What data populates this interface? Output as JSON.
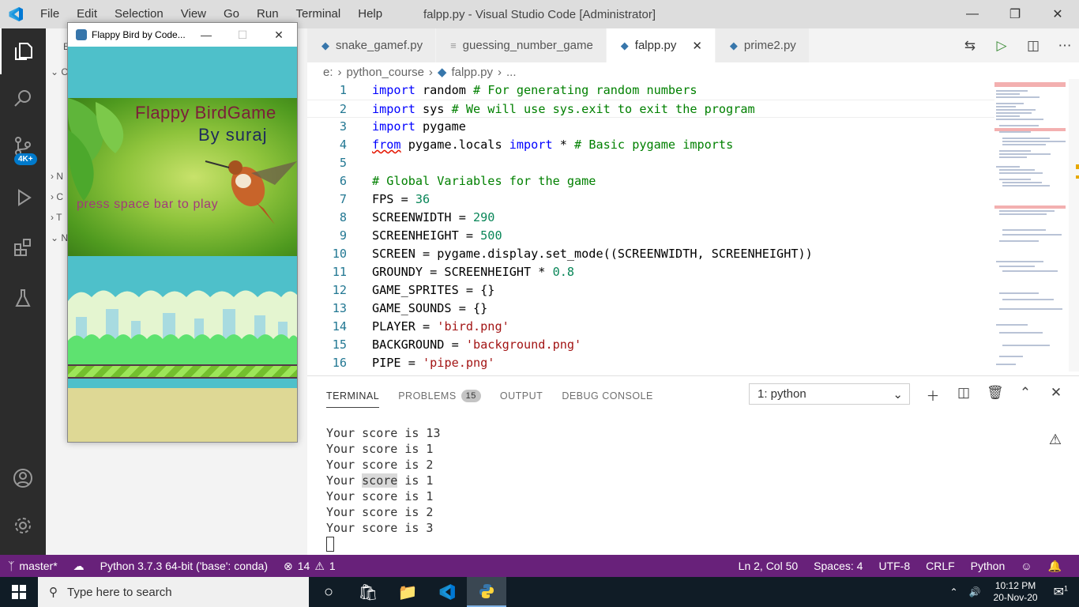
{
  "window": {
    "title": "falpp.py - Visual Studio Code [Administrator]",
    "menus": [
      "File",
      "Edit",
      "Selection",
      "View",
      "Go",
      "Run",
      "Terminal",
      "Help"
    ]
  },
  "activity": {
    "scm_badge": "4K+"
  },
  "sidebar": {
    "rows": [
      "E",
      "C",
      "N",
      "C",
      "T",
      "N"
    ]
  },
  "tabs": [
    {
      "label": "snake_gamef.py",
      "icon": "python-icon"
    },
    {
      "label": "guessing_number_game",
      "icon": "file-lines-icon"
    },
    {
      "label": "falpp.py",
      "icon": "python-icon",
      "active": true
    },
    {
      "label": "prime2.py",
      "icon": "python-icon"
    }
  ],
  "breadcrumbs": {
    "drive": "e:",
    "folder": "python_course",
    "file": "falpp.py",
    "more": "..."
  },
  "code": {
    "line_numbers": [
      "1",
      "2",
      "3",
      "4",
      "5",
      "6",
      "7",
      "8",
      "9",
      "10",
      "11",
      "12",
      "13",
      "14",
      "15",
      "16"
    ],
    "l1": {
      "kw": "import",
      "name": " random ",
      "cm": "# For generating random numbers"
    },
    "l2": {
      "kw": "import",
      "name": " sys ",
      "cm": "# We will use sys.exit to exit the program"
    },
    "l3": {
      "kw": "import",
      "name": " pygame"
    },
    "l4": {
      "kw": "from",
      "name": " pygame.locals ",
      "kw2": "import",
      "rest": " * ",
      "cm": "# Basic pygame imports"
    },
    "l6": {
      "cm": "# Global Variables for the game"
    },
    "l7": {
      "name": "FPS = ",
      "num": "36"
    },
    "l8": {
      "name": "SCREENWIDTH = ",
      "num": "290"
    },
    "l9": {
      "name": "SCREENHEIGHT = ",
      "num": "500"
    },
    "l10": {
      "name": "SCREEN = pygame.display.set_mode((SCREENWIDTH, SCREENHEIGHT))"
    },
    "l11": {
      "name": "GROUNDY = SCREENHEIGHT * ",
      "num": "0.8"
    },
    "l12": {
      "name": "GAME_SPRITES = {}"
    },
    "l13": {
      "name": "GAME_SOUNDS = {}"
    },
    "l14": {
      "name": "PLAYER = ",
      "str": "'bird.png'"
    },
    "l15": {
      "name": "BACKGROUND = ",
      "str": "'background.png'"
    },
    "l16": {
      "name": "PIPE = ",
      "str": "'pipe.png'"
    }
  },
  "panel": {
    "tabs": [
      "TERMINAL",
      "PROBLEMS",
      "OUTPUT",
      "DEBUG CONSOLE"
    ],
    "problems_count": "15",
    "terminal_select": "1: python",
    "output_prefix": "Your ",
    "output_highlight": "score",
    "output_lines": [
      "Your score is 13",
      "Your score is 1",
      "Your score is 2",
      " is 1",
      "Your score is 1",
      "Your score is 2",
      "Your score is 3"
    ]
  },
  "statusbar": {
    "branch": "master*",
    "interpreter": "Python 3.7.3 64-bit ('base': conda)",
    "errors": "14",
    "warnings": "1",
    "position": "Ln 2, Col 50",
    "spaces": "Spaces: 4",
    "encoding": "UTF-8",
    "eol": "CRLF",
    "language": "Python"
  },
  "taskbar": {
    "search_placeholder": "Type here to search",
    "time": "10:12 PM",
    "date": "20-Nov-20",
    "notifications": "1"
  },
  "pygame_window": {
    "title": "Flappy Bird by Code...",
    "splash_title": "Flappy BirdGame",
    "splash_sub": "By suraj",
    "splash_press": "press space bar to play"
  },
  "colors": {
    "statusbar": "#68217a",
    "activity_bar": "#2c2c2c",
    "accent": "#007acc"
  }
}
